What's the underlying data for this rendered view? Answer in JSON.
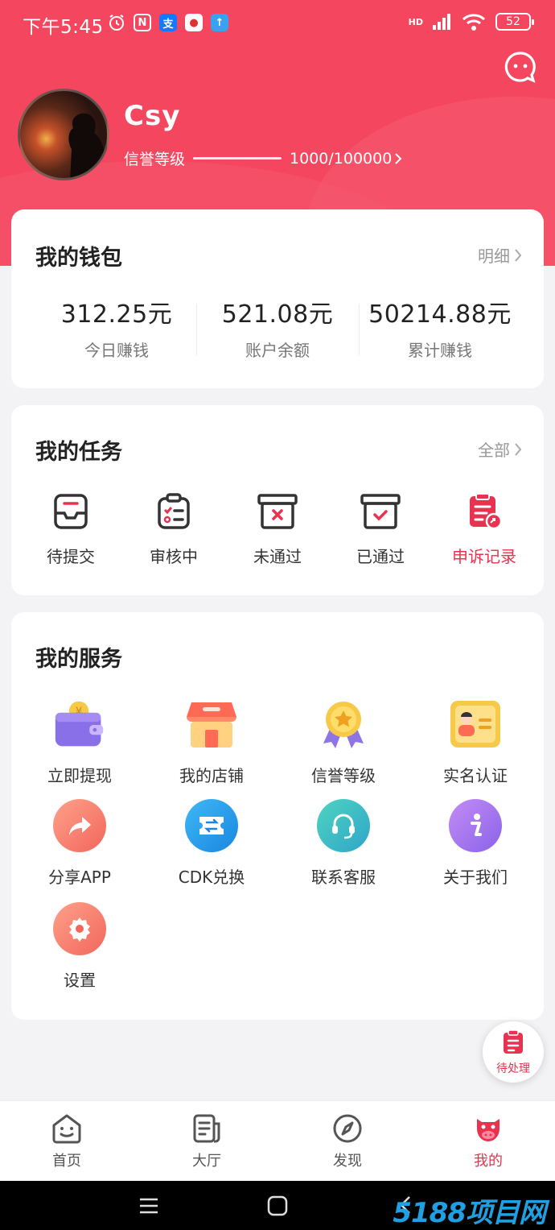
{
  "status_bar": {
    "time": "下午5:45",
    "signal": "HD",
    "battery": "52"
  },
  "profile": {
    "name": "Csy",
    "level_label": "信誉等级",
    "level_value": "1000/100000",
    "level_progress": 0.01
  },
  "wallet": {
    "title": "我的钱包",
    "more": "明细",
    "stats": [
      {
        "value": "312.25元",
        "label": "今日赚钱"
      },
      {
        "value": "521.08元",
        "label": "账户余额"
      },
      {
        "value": "50214.88元",
        "label": "累计赚钱"
      }
    ]
  },
  "tasks": {
    "title": "我的任务",
    "more": "全部",
    "items": [
      {
        "label": "待提交",
        "icon": "inbox-icon"
      },
      {
        "label": "审核中",
        "icon": "checklist-icon"
      },
      {
        "label": "未通过",
        "icon": "box-x-icon"
      },
      {
        "label": "已通过",
        "icon": "box-check-icon"
      },
      {
        "label": "申诉记录",
        "icon": "appeal-doc-icon"
      }
    ]
  },
  "services": {
    "title": "我的服务",
    "items": [
      {
        "label": "立即提现",
        "icon": "wallet-icon"
      },
      {
        "label": "我的店铺",
        "icon": "shop-icon"
      },
      {
        "label": "信誉等级",
        "icon": "medal-icon"
      },
      {
        "label": "实名认证",
        "icon": "id-card-icon"
      },
      {
        "label": "分享APP",
        "icon": "share-icon"
      },
      {
        "label": "CDK兑换",
        "icon": "ticket-icon"
      },
      {
        "label": "联系客服",
        "icon": "headset-icon"
      },
      {
        "label": "关于我们",
        "icon": "info-icon"
      },
      {
        "label": "设置",
        "icon": "settings-icon"
      }
    ]
  },
  "float_button": {
    "label": "待处理"
  },
  "tabbar": {
    "items": [
      {
        "label": "首页",
        "active": false
      },
      {
        "label": "大厅",
        "active": false
      },
      {
        "label": "发现",
        "active": false
      },
      {
        "label": "我的",
        "active": true
      }
    ],
    "active_color": "#e83350"
  },
  "watermark": "5188项目网",
  "colors": {
    "brand": "#f4475f",
    "accent": "#e83350"
  }
}
